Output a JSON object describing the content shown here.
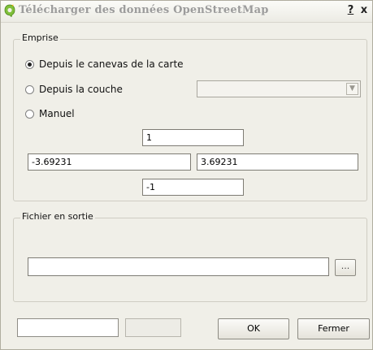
{
  "window": {
    "title": "Télécharger des données OpenStreetMap",
    "help_label": "?",
    "close_label": "x"
  },
  "extent": {
    "group_label": "Emprise",
    "options": [
      {
        "label": "Depuis le canevas de la carte",
        "checked": true
      },
      {
        "label": "Depuis la couche",
        "checked": false
      },
      {
        "label": "Manuel",
        "checked": false
      }
    ],
    "layer_combo_value": "",
    "north": "1",
    "west": "-3.69231",
    "east": "3.69231",
    "south": "-1"
  },
  "output": {
    "group_label": "Fichier en sortie",
    "file_path": "",
    "browse_label": "..."
  },
  "footer": {
    "ok_label": "OK",
    "close_label": "Fermer"
  },
  "icons": {
    "app": "qgis-icon",
    "combo_arrow": "chevron-down-icon"
  }
}
